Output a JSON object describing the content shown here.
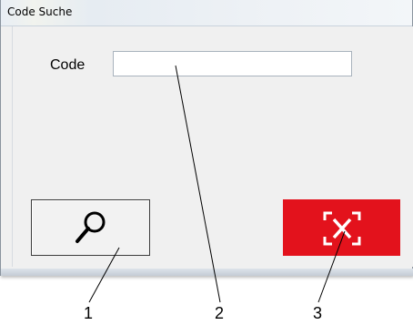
{
  "window": {
    "title": "Code Suche"
  },
  "form": {
    "code_label": "Code",
    "code_value": "",
    "code_placeholder": ""
  },
  "buttons": {
    "search_icon": "magnifier-icon",
    "cancel_icon": "cancel-x-icon",
    "cancel_color": "#e3121c"
  },
  "callouts": {
    "one": "1",
    "two": "2",
    "three": "3"
  }
}
